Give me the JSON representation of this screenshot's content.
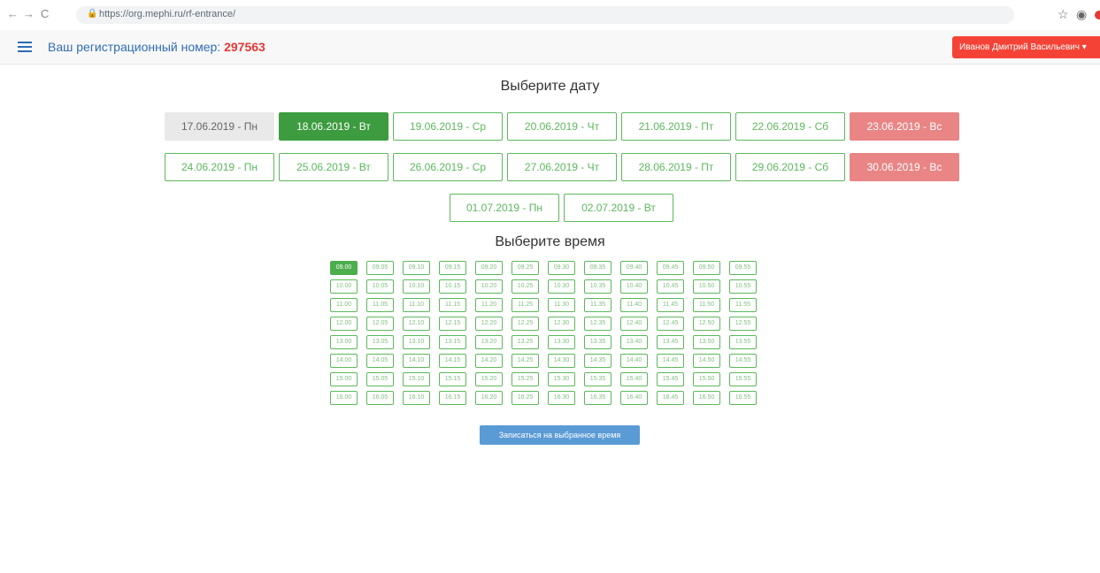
{
  "browser": {
    "url": "https://org.mephi.ru/rf-entrance/",
    "back_icon": "←",
    "forward_icon": "→",
    "reload_icon": "C"
  },
  "header": {
    "reg_label": "Ваш регистрационный номер:",
    "reg_number": "297563",
    "user_name": "Иванов Дмитрий Васильевич ▾"
  },
  "date_section": {
    "title": "Выберите дату",
    "rows": [
      [
        {
          "label": "17.06.2019 - Пн",
          "state": "past"
        },
        {
          "label": "18.06.2019 - Вт",
          "state": "active"
        },
        {
          "label": "19.06.2019 - Ср",
          "state": "available"
        },
        {
          "label": "20.06.2019 - Чт",
          "state": "available"
        },
        {
          "label": "21.06.2019 - Пт",
          "state": "available"
        },
        {
          "label": "22.06.2019 - Сб",
          "state": "available"
        },
        {
          "label": "23.06.2019 - Вс",
          "state": "weekend"
        }
      ],
      [
        {
          "label": "24.06.2019 - Пн",
          "state": "available"
        },
        {
          "label": "25.06.2019 - Вт",
          "state": "available"
        },
        {
          "label": "26.06.2019 - Ср",
          "state": "available"
        },
        {
          "label": "27.06.2019 - Чт",
          "state": "available"
        },
        {
          "label": "28.06.2019 - Пт",
          "state": "available"
        },
        {
          "label": "29.06.2019 - Сб",
          "state": "available"
        },
        {
          "label": "30.06.2019 - Вс",
          "state": "weekend"
        }
      ],
      [
        {
          "label": "01.07.2019 - Пн",
          "state": "available"
        },
        {
          "label": "02.07.2019 - Вт",
          "state": "available"
        }
      ]
    ]
  },
  "time_section": {
    "title": "Выберите время",
    "selected": "09.00",
    "slots": [
      [
        "09.00",
        "09.05",
        "09.10",
        "09.15",
        "09.20",
        "09.25",
        "09.30",
        "09.35",
        "09.40",
        "09.45",
        "09.50",
        "09.55"
      ],
      [
        "10.00",
        "10.05",
        "10.10",
        "10.15",
        "10.20",
        "10.25",
        "10.30",
        "10.35",
        "10.40",
        "10.45",
        "10.50",
        "10.55"
      ],
      [
        "11.00",
        "11.05",
        "11.10",
        "11.15",
        "11.20",
        "11.25",
        "11.30",
        "11.35",
        "11.40",
        "11.45",
        "11.50",
        "11.55"
      ],
      [
        "12.00",
        "12.05",
        "12.10",
        "12.15",
        "12.20",
        "12.25",
        "12.30",
        "12.35",
        "12.40",
        "12.45",
        "12.50",
        "12.55"
      ],
      [
        "13.00",
        "13.05",
        "13.10",
        "13.15",
        "13.20",
        "13.25",
        "13.30",
        "13.35",
        "13.40",
        "13.45",
        "13.50",
        "13.55"
      ],
      [
        "14.00",
        "14.05",
        "14.10",
        "14.15",
        "14.20",
        "14.25",
        "14.30",
        "14.35",
        "14.40",
        "14.45",
        "14.50",
        "14.55"
      ],
      [
        "15.00",
        "15.05",
        "15.10",
        "15.15",
        "15.20",
        "15.25",
        "15.30",
        "15.35",
        "15.40",
        "15.45",
        "15.50",
        "15.55"
      ],
      [
        "16.00",
        "16.05",
        "16.10",
        "16.15",
        "16.20",
        "16.25",
        "16.30",
        "16.35",
        "16.40",
        "16.45",
        "16.50",
        "16.55"
      ]
    ]
  },
  "submit_label": "Записаться на выбранное время"
}
